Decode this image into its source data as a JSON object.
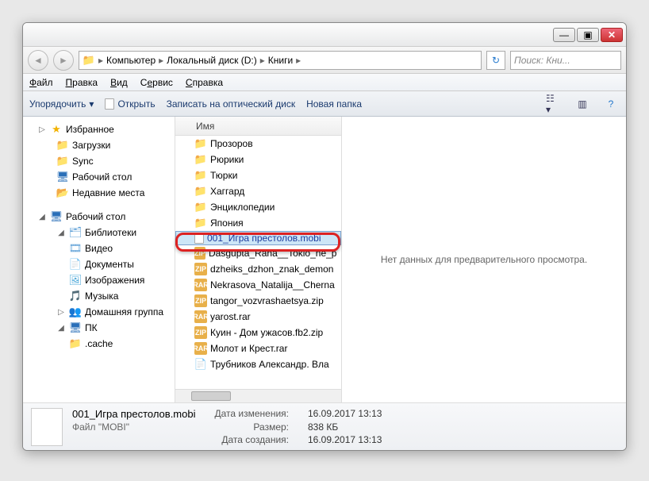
{
  "window_controls": {
    "min": "—",
    "max": "▣",
    "close": "✕"
  },
  "nav": {
    "back": "◄",
    "fwd": "►",
    "path": [
      "Компьютер",
      "Локальный диск (D:)",
      "Книги"
    ],
    "refresh": "↻",
    "search_placeholder": "Поиск: Кни...",
    "search_icon": "🔍"
  },
  "menu": {
    "file": "Файл",
    "edit": "Правка",
    "view": "Вид",
    "tools": "Сервис",
    "help": "Справка"
  },
  "toolbar": {
    "organize": "Упорядочить",
    "arrow": "▾",
    "open": "Открыть",
    "burn": "Записать на оптический диск",
    "newfolder": "Новая папка",
    "help": "?"
  },
  "sidebar": {
    "fav": "Избранное",
    "downloads": "Загрузки",
    "sync": "Sync",
    "desktop": "Рабочий стол",
    "recent": "Недавние места",
    "desktop2": "Рабочий стол",
    "libraries": "Библиотеки",
    "video": "Видео",
    "documents": "Документы",
    "pictures": "Изображения",
    "music": "Музыка",
    "homegroup": "Домашняя группа",
    "pc": "ПК",
    "cache": ".cache"
  },
  "columns": {
    "name": "Имя"
  },
  "files": [
    {
      "type": "folder",
      "name": "Прозоров"
    },
    {
      "type": "folder",
      "name": "Рюрики"
    },
    {
      "type": "folder",
      "name": "Тюрки"
    },
    {
      "type": "folder",
      "name": "Хаггард"
    },
    {
      "type": "folder",
      "name": "Энциклопедии"
    },
    {
      "type": "folder",
      "name": "Япония"
    },
    {
      "type": "file",
      "name": "001_Игра престолов.mobi",
      "selected": true
    },
    {
      "type": "zip",
      "name": "Dasgupta_Rana__Tokio_ne_p"
    },
    {
      "type": "zip",
      "name": "dzheiks_dzhon_znak_demon"
    },
    {
      "type": "rar",
      "name": "Nekrasova_Natalija__Cherna"
    },
    {
      "type": "zip",
      "name": "tangor_vozvrashaetsya.zip"
    },
    {
      "type": "rar",
      "name": "yarost.rar"
    },
    {
      "type": "zip",
      "name": "Куин - Дом ужасов.fb2.zip"
    },
    {
      "type": "rar",
      "name": "Молот и Крест.rar"
    },
    {
      "type": "page",
      "name": "Трубников Александр. Вла"
    }
  ],
  "preview": {
    "empty": "Нет данных для предварительного просмотра."
  },
  "details": {
    "filename": "001_Игра престолов.mobi",
    "filetype": "Файл \"MOBI\"",
    "modified_label": "Дата изменения:",
    "modified": "16.09.2017 13:13",
    "size_label": "Размер:",
    "size": "838 КБ",
    "created_label": "Дата создания:",
    "created": "16.09.2017 13:13"
  }
}
